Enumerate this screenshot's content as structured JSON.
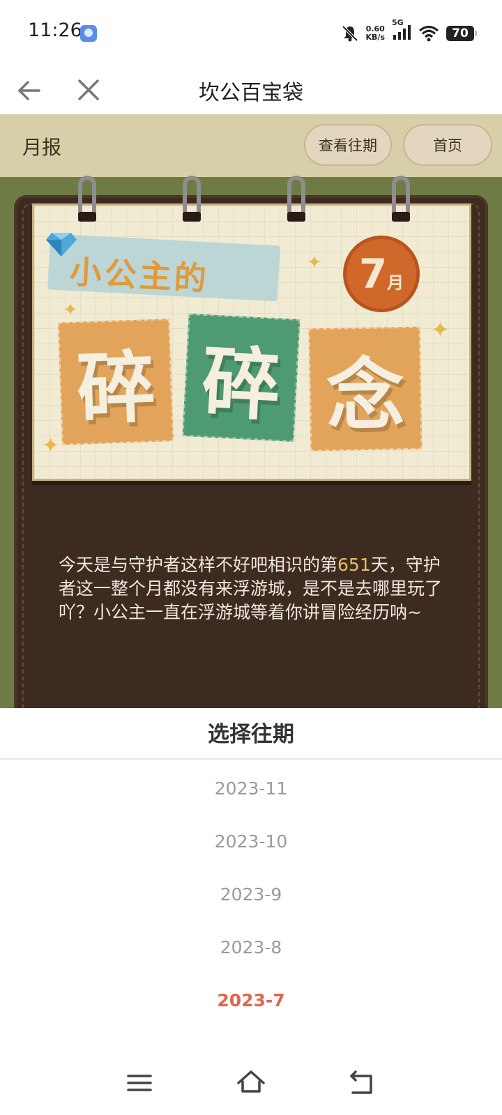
{
  "status_bar": {
    "time": "11:26",
    "net_speed_value": "0.60",
    "net_speed_unit": "KB/s",
    "signal_label": "5G",
    "battery": "70"
  },
  "navbar": {
    "title": "坎公百宝袋",
    "back_icon": "arrow-left-icon",
    "close_icon": "close-icon"
  },
  "page_header": {
    "label": "月报",
    "history_button": "查看往期",
    "home_button": "首页"
  },
  "banner": {
    "subtitle": "小公主的",
    "chars": [
      "碎",
      "碎",
      "念"
    ],
    "month_number": "7",
    "month_suffix": "月"
  },
  "story": {
    "before": "今天是与守护者这样不好吧相识的第",
    "days": "651",
    "after": "天，守护者这一整个月都没有来浮游城，是不是去哪里玩了吖？小公主一直在浮游城等着你讲冒险经历呐~"
  },
  "sheet": {
    "title": "选择往期",
    "periods": [
      "2023-11",
      "2023-10",
      "2023-9",
      "2023-8",
      "2023-7"
    ],
    "selected": "2023-7"
  },
  "colors": {
    "accent_selected": "#e06650",
    "header_bg": "#d7cfa9",
    "board_bg": "#3d2a21",
    "highlight": "#e9c15d"
  },
  "system_nav": {
    "menu_icon": "menu-icon",
    "home_icon": "home-icon",
    "back_icon": "back-icon"
  }
}
